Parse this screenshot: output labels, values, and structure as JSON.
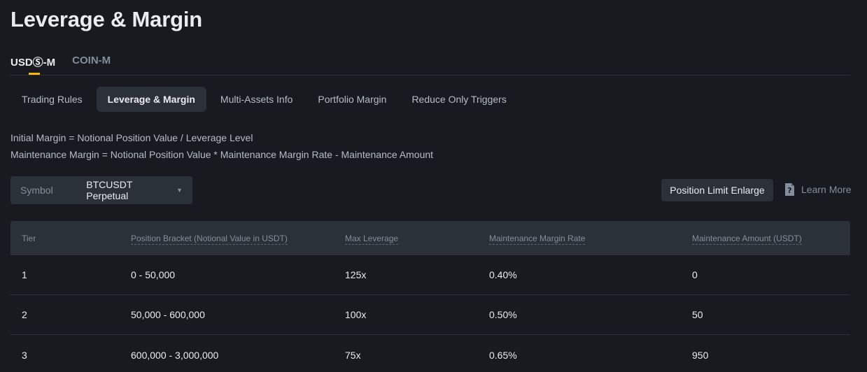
{
  "page": {
    "title": "Leverage & Margin"
  },
  "contract_tabs": [
    {
      "label": "USDⓈ-M",
      "active": true
    },
    {
      "label": "COIN-M",
      "active": false
    }
  ],
  "sub_tabs": [
    {
      "label": "Trading Rules",
      "active": false
    },
    {
      "label": "Leverage & Margin",
      "active": true
    },
    {
      "label": "Multi-Assets Info",
      "active": false
    },
    {
      "label": "Portfolio Margin",
      "active": false
    },
    {
      "label": "Reduce Only Triggers",
      "active": false
    }
  ],
  "formulas": {
    "initial": "Initial Margin = Notional Position Value / Leverage Level",
    "maintenance": "Maintenance Margin = Notional Position Value * Maintenance Margin Rate - Maintenance Amount"
  },
  "symbol_select": {
    "label": "Symbol",
    "value": "BTCUSDT Perpetual"
  },
  "actions": {
    "position_limit": "Position Limit Enlarge",
    "learn_more": "Learn More",
    "learn_icon": "question-doc-icon"
  },
  "table": {
    "headers": [
      "Tier",
      "Position Bracket (Notional Value in USDT)",
      "Max Leverage",
      "Maintenance Margin Rate",
      "Maintenance Amount (USDT)"
    ],
    "rows": [
      [
        "1",
        "0 - 50,000",
        "125x",
        "0.40%",
        "0"
      ],
      [
        "2",
        "50,000 - 600,000",
        "100x",
        "0.50%",
        "50"
      ],
      [
        "3",
        "600,000 - 3,000,000",
        "75x",
        "0.65%",
        "950"
      ]
    ]
  },
  "colors": {
    "accent": "#f0b90b",
    "bg": "#181a20",
    "panel": "#2b3139"
  }
}
